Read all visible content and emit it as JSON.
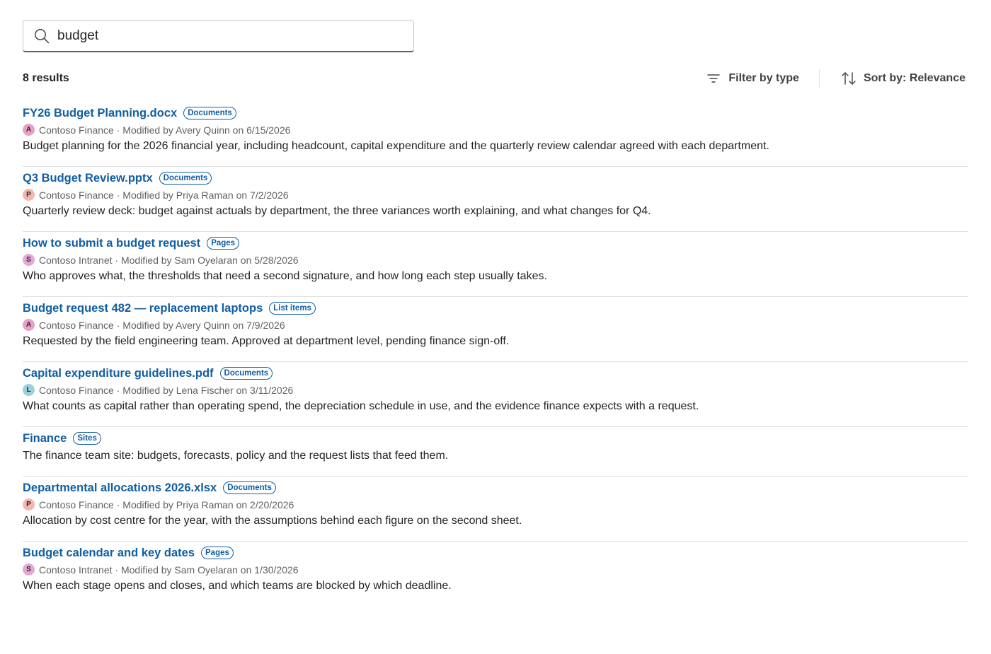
{
  "search": {
    "value": "budget",
    "icon": "search-icon"
  },
  "toolbar": {
    "results_count": "8 results",
    "filter_label": "Filter by type",
    "filter_icon": "filter-icon",
    "sort_label": "Sort by: Relevance",
    "sort_icon": "sort-icon"
  },
  "colors": {
    "link": "#115ea3",
    "text": "#242424",
    "meta": "#616161",
    "divider": "#e0e0e0"
  },
  "results": [
    {
      "title": "FY26 Budget Planning.docx",
      "type": "Documents",
      "avatar": "A",
      "avatar_color": "#e8a0c8",
      "meta": "Contoso Finance · Modified by Avery Quinn on 6/15/2026",
      "description": "Budget planning for the 2026 financial year, including headcount, capital expenditure and the quarterly review calendar agreed with each department."
    },
    {
      "title": "Q3 Budget Review.pptx",
      "type": "Documents",
      "avatar": "P",
      "avatar_color": "#f4b6b0",
      "meta": "Contoso Finance · Modified by Priya Raman on 7/2/2026",
      "description": "Quarterly review deck: budget against actuals by department, the three variances worth explaining, and what changes for Q4."
    },
    {
      "title": "How to submit a budget request",
      "type": "Pages",
      "avatar": "S",
      "avatar_color": "#e6a6d6",
      "meta": "Contoso Intranet · Modified by Sam Oyelaran on 5/28/2026",
      "description": "Who approves what, the thresholds that need a second signature, and how long each step usually takes."
    },
    {
      "title": "Budget request 482 — replacement laptops",
      "type": "List items",
      "avatar": "A",
      "avatar_color": "#e8a0c8",
      "meta": "Contoso Finance · Modified by Avery Quinn on 7/9/2026",
      "description": "Requested by the field engineering team. Approved at department level, pending finance sign-off."
    },
    {
      "title": "Capital expenditure guidelines.pdf",
      "type": "Documents",
      "avatar": "L",
      "avatar_color": "#9fcfdc",
      "meta": "Contoso Finance · Modified by Lena Fischer on 3/11/2026",
      "description": "What counts as capital rather than operating spend, the depreciation schedule in use, and the evidence finance expects with a request."
    },
    {
      "title": "Finance",
      "type": "Sites",
      "avatar": "",
      "avatar_color": "",
      "meta": "",
      "description": "The finance team site: budgets, forecasts, policy and the request lists that feed them."
    },
    {
      "title": "Departmental allocations 2026.xlsx",
      "type": "Documents",
      "avatar": "P",
      "avatar_color": "#f4b6b0",
      "meta": "Contoso Finance · Modified by Priya Raman on 2/20/2026",
      "description": "Allocation by cost centre for the year, with the assumptions behind each figure on the second sheet."
    },
    {
      "title": "Budget calendar and key dates",
      "type": "Pages",
      "avatar": "S",
      "avatar_color": "#e6a6d6",
      "meta": "Contoso Intranet · Modified by Sam Oyelaran on 1/30/2026",
      "description": "When each stage opens and closes, and which teams are blocked by which deadline."
    }
  ]
}
